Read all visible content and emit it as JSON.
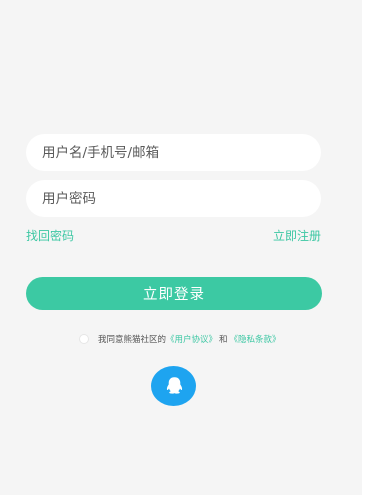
{
  "login": {
    "username_placeholder": "用户名/手机号/邮箱",
    "password_placeholder": "用户密码",
    "forgot_password": "找回密码",
    "register": "立即注册",
    "login_button": "立即登录"
  },
  "agreement": {
    "prefix": "我同意熊猫社区的",
    "user_agreement": "《用户协议》",
    "conjunction": "和",
    "privacy_policy": "《隐私条款》"
  },
  "social": {
    "qq_icon": "qq-penguin-icon"
  },
  "colors": {
    "accent": "#3cc9a3",
    "qq_blue": "#1ea4f0",
    "background": "#f5f5f5"
  }
}
